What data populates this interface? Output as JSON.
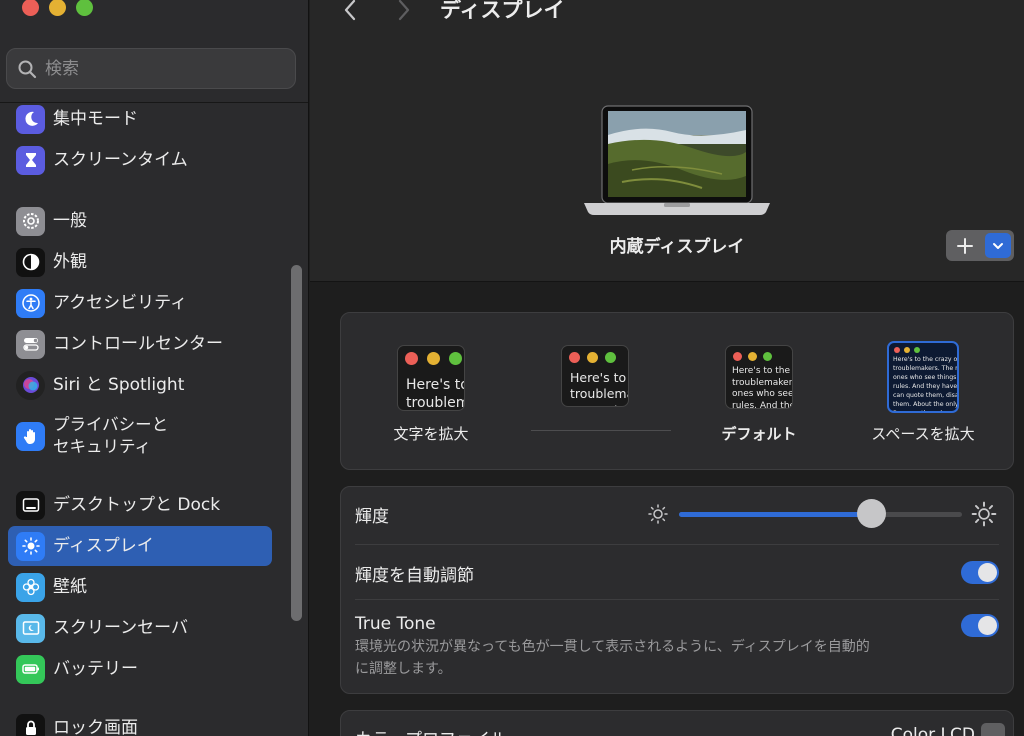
{
  "window": {
    "title": "ディスプレイ"
  },
  "sidebar": {
    "search_placeholder": "検索",
    "items": [
      {
        "label": "集中モード",
        "icon": "moon-icon",
        "color": "#5b5ce0"
      },
      {
        "label": "スクリーンタイム",
        "icon": "hourglass-icon",
        "color": "#5b5ce0"
      },
      {
        "label": "一般",
        "icon": "gear-icon",
        "color": "#8e8e93"
      },
      {
        "label": "外観",
        "icon": "appearance-icon",
        "color": "#111111"
      },
      {
        "label": "アクセシビリティ",
        "icon": "accessibility-icon",
        "color": "#2f7cf6"
      },
      {
        "label": "コントロールセンター",
        "icon": "toggles-icon",
        "color": "#8e8e93"
      },
      {
        "label": "Siri と Spotlight",
        "icon": "siri-icon",
        "color": "#222222"
      },
      {
        "label_line1": "プライバシーと",
        "label_line2": "セキュリティ",
        "icon": "hand-icon",
        "color": "#2f7cf6"
      },
      {
        "label": "デスクトップと Dock",
        "icon": "dock-icon",
        "color": "#111111"
      },
      {
        "label": "ディスプレイ",
        "icon": "sun-icon",
        "color": "#2f7cf6",
        "active": true
      },
      {
        "label": "壁紙",
        "icon": "flower-icon",
        "color": "#3aa3e8"
      },
      {
        "label": "スクリーンセーバ",
        "icon": "screensaver-icon",
        "color": "#59b8e9"
      },
      {
        "label": "バッテリー",
        "icon": "battery-icon",
        "color": "#34c759"
      },
      {
        "label": "ロック画面",
        "icon": "lock-icon",
        "color": "#111111"
      }
    ]
  },
  "header": {
    "title": "ディスプレイ"
  },
  "display": {
    "name": "内蔵ディスプレイ"
  },
  "resolution": {
    "options": [
      {
        "label": "文字を拡大",
        "sample": "Here's to\ntroublem"
      },
      {
        "label": "",
        "sample": "Here's to t\ntroublema\nones who"
      },
      {
        "label": "デフォルト",
        "sample": "Here's to the cr\ntroublemakers.\nones who see t\nrules. And they"
      },
      {
        "label": "スペースを拡大",
        "sample": "Here's to the crazy one\ntroublemakers. The rou\nones who see things dif\nrules. And they have no\ncan quote them, disagre\nthem. About the only th\nBecause they change th",
        "selected": true
      }
    ]
  },
  "brightness": {
    "label": "輝度",
    "value": 0.68
  },
  "auto_brightness": {
    "label": "輝度を自動調節",
    "on": true
  },
  "true_tone": {
    "label": "True Tone",
    "description_line1": "環境光の状況が異なっても色が一貫して表示されるように、ディスプレイを自動的",
    "description_line2": "に調整します。",
    "on": true
  },
  "color_profile": {
    "label": "カラープロファイル",
    "value": "Color LCD"
  },
  "colors": {
    "accent": "#2f6bd6",
    "sidebar_active": "#2e5fb3"
  }
}
